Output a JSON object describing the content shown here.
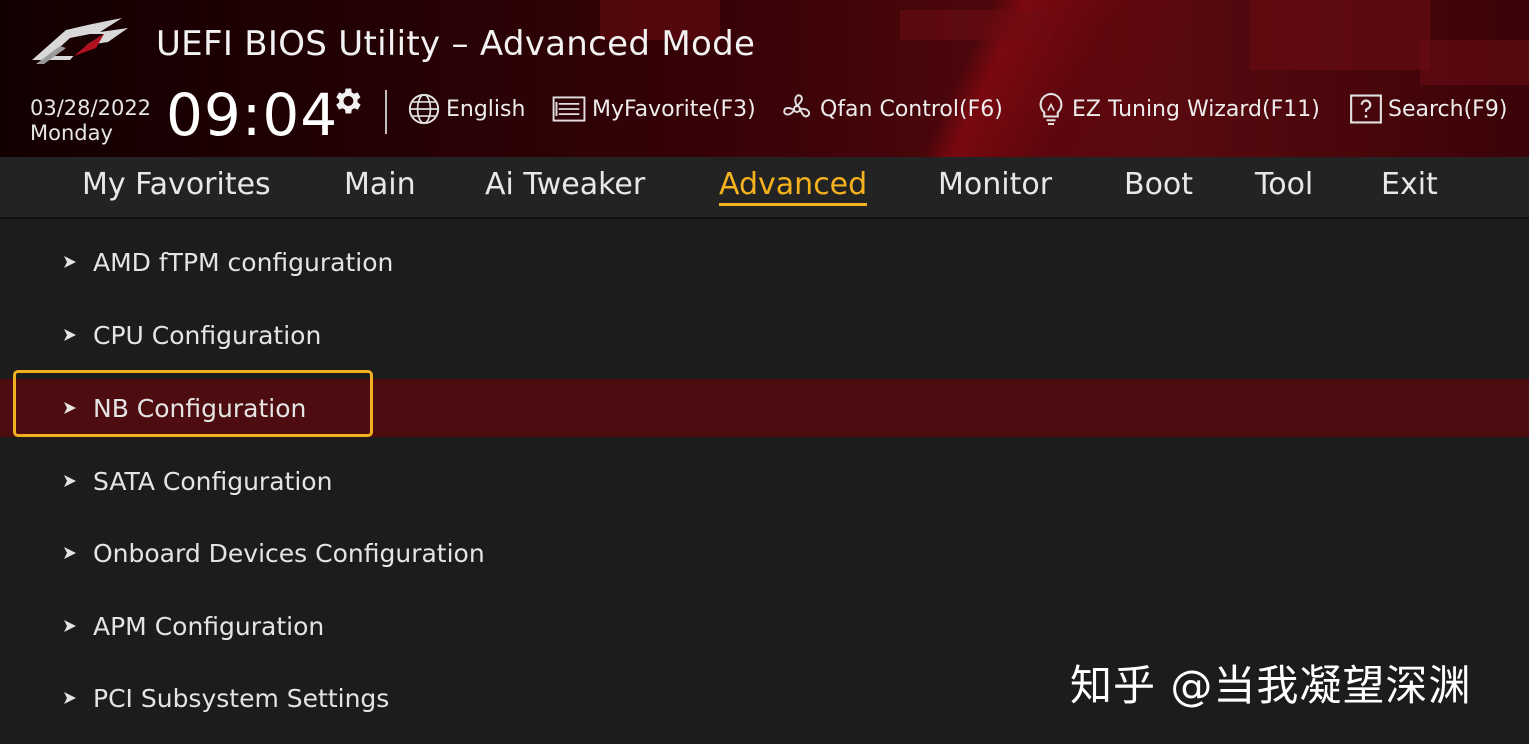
{
  "header": {
    "title": "UEFI BIOS Utility – Advanced Mode",
    "logo_icon": "rog-eye-logo",
    "date": "03/28/2022",
    "weekday": "Monday",
    "time": "09:04",
    "settings_icon": "gear-icon",
    "tools": [
      {
        "label": "English",
        "icon": "globe-icon"
      },
      {
        "label": "MyFavorite(F3)",
        "icon": "favorite-list-icon"
      },
      {
        "label": "Qfan Control(F6)",
        "icon": "fan-icon"
      },
      {
        "label": "EZ Tuning Wizard(F11)",
        "icon": "lightbulb-icon"
      },
      {
        "label": "Search(F9)",
        "icon": "question-box-icon"
      }
    ]
  },
  "nav": {
    "tabs": [
      {
        "label": "My Favorites",
        "active": false
      },
      {
        "label": "Main",
        "active": false
      },
      {
        "label": "Ai Tweaker",
        "active": false
      },
      {
        "label": "Advanced",
        "active": true
      },
      {
        "label": "Monitor",
        "active": false
      },
      {
        "label": "Boot",
        "active": false
      },
      {
        "label": "Tool",
        "active": false
      },
      {
        "label": "Exit",
        "active": false
      }
    ]
  },
  "menu": {
    "items": [
      {
        "label": "AMD fTPM configuration",
        "selected": false
      },
      {
        "label": "CPU Configuration",
        "selected": false
      },
      {
        "label": "NB Configuration",
        "selected": true
      },
      {
        "label": "SATA Configuration",
        "selected": false
      },
      {
        "label": "Onboard Devices Configuration",
        "selected": false
      },
      {
        "label": "APM Configuration",
        "selected": false
      },
      {
        "label": "PCI Subsystem Settings",
        "selected": false
      }
    ]
  },
  "watermark": "知乎 @当我凝望深渊",
  "colors": {
    "accent": "#f5b21c",
    "selected_row": "#4d0d10",
    "background": "#1c1c1c",
    "header_red": "#5a0a10"
  }
}
